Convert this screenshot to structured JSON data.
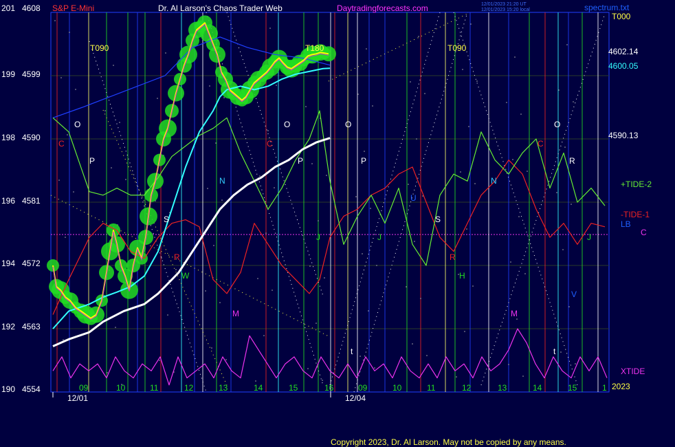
{
  "header": {
    "symbol": "S&P E-Mini",
    "author": "Dr. Al Larson's Chaos Trader Web",
    "site": "Daytradingforecasts.com",
    "stamp_line1": "12/01/2023 21:20 UT",
    "stamp_line2": "12/01/2023 15:20 local",
    "corner": "spectrum.txt"
  },
  "footer": {
    "copyright": "Copyright 2023, Dr. Al Larson. May not be copied by any means."
  },
  "colors": {
    "background": "#00003f",
    "price": "#ffff00",
    "avg_fast": "#33ffff",
    "avg_slow": "#ffffff",
    "tide2": "#66ee33",
    "tide1": "#ee2222",
    "xtide": "#ee33ee",
    "glow": "#22dd22",
    "blue_line": "#1f3fff"
  },
  "chart_data": {
    "type": "line",
    "title": "S&P E-Mini",
    "y_left_labels": [
      "201",
      "199",
      "198",
      "196",
      "194",
      "192",
      "190"
    ],
    "y_price_labels": [
      "4608",
      "4599",
      "4590",
      "4581",
      "4572",
      "4563",
      "4554"
    ],
    "ylim": [
      4554,
      4608
    ],
    "x_hour_labels": [
      "09",
      "10",
      "11",
      "12",
      "13",
      "14",
      "15",
      "16",
      "09",
      "10",
      "11",
      "12",
      "13",
      "14",
      "15",
      "1"
    ],
    "x_date_labels": [
      "12/01",
      "12/04"
    ],
    "year_label": "2023",
    "right_labels": {
      "t000": "T000",
      "price_level_1": "4602.14",
      "price_level_2": "4600.05",
      "price_level_3": "4590.13",
      "tide2": "+TIDE-2",
      "tide1": "-TIDE-1",
      "lb": "LB",
      "c": "C",
      "xtide": "XTIDE"
    },
    "markers": {
      "t090_a": "T090",
      "t180": "T180",
      "t090_b": "T090",
      "o": "O",
      "p": "P",
      "n": "N",
      "c": "C",
      "s": "S",
      "r": "R",
      "h": "H",
      "m": "M",
      "t": "t",
      "u": "U",
      "j": "J",
      "w": "W",
      "v": "V"
    },
    "series": [
      {
        "name": "price",
        "x": [
          77,
          82,
          88,
          95,
          102,
          110,
          118,
          125,
          132,
          140,
          148,
          155,
          160,
          165,
          170,
          176,
          182,
          188,
          194,
          200,
          206,
          212,
          216,
          220,
          226,
          232,
          238,
          244,
          250,
          256,
          262,
          268,
          274,
          280,
          286,
          292,
          298,
          304,
          310,
          316,
          322,
          328,
          334,
          340,
          346,
          352,
          358,
          364,
          370,
          376,
          382,
          388,
          394,
          400,
          406,
          412,
          418,
          424,
          430,
          436,
          442,
          448,
          454,
          460,
          466,
          472,
          478
        ],
        "values": [
          4572,
          4569,
          4568.5,
          4567.5,
          4567,
          4566,
          4565.5,
          4565,
          4564.5,
          4565,
          4567,
          4571,
          4574,
          4577,
          4575,
          4572,
          4570.5,
          4568.5,
          4572,
          4574.5,
          4573,
          4576,
          4579,
          4582,
          4584,
          4587,
          4590,
          4591.5,
          4594,
          4596.5,
          4598.5,
          4600.5,
          4602,
          4604,
          4605.5,
          4606,
          4606.5,
          4605,
          4603.5,
          4602,
          4599.5,
          4598.5,
          4597,
          4596.5,
          4596,
          4595.5,
          4596,
          4597,
          4598,
          4598.5,
          4599,
          4599.5,
          4600.2,
          4601,
          4601.5,
          4600.8,
          4600.2,
          4600,
          4600.4,
          4600.8,
          4601.2,
          4601.8,
          4602,
          4602.1,
          4602.3,
          4602.2,
          4602.1
        ]
      },
      {
        "name": "avg_fast",
        "x": [
          77,
          100,
          130,
          150,
          170,
          190,
          210,
          230,
          250,
          270,
          290,
          310,
          320,
          330,
          350,
          370,
          390,
          410,
          430,
          450,
          470,
          480
        ],
        "values": [
          4563,
          4565.5,
          4566.5,
          4567.5,
          4568.2,
          4569,
          4570.5,
          4574,
          4580,
          4586,
          4591,
          4594,
          4596,
          4597,
          4597.5,
          4597,
          4597.5,
          4598.5,
          4599.2,
          4599.6,
          4600,
          4600.05
        ]
      },
      {
        "name": "avg_slow",
        "x": [
          77,
          100,
          130,
          150,
          180,
          210,
          230,
          260,
          280,
          300,
          320,
          340,
          360,
          380,
          400,
          420,
          440,
          460,
          480
        ],
        "values": [
          4560.5,
          4561.5,
          4562.5,
          4564,
          4565.5,
          4566.5,
          4568,
          4571,
          4574,
          4577,
          4580,
          4582,
          4583.5,
          4584.5,
          4586,
          4587,
          4588.5,
          4589.5,
          4590.13
        ]
      },
      {
        "name": "+TIDE-2",
        "x": [
          77,
          100,
          130,
          150,
          170,
          190,
          210,
          230,
          250,
          270,
          290,
          310,
          330,
          350,
          370,
          390,
          410,
          430,
          450,
          465,
          480,
          500,
          520,
          540,
          560,
          580,
          600,
          620,
          640,
          660,
          680,
          700,
          720,
          740,
          760,
          780,
          800,
          820,
          840,
          860,
          880
        ],
        "values": [
          4593,
          4591,
          4582.5,
          4582,
          4583,
          4582,
          4582,
          4584.5,
          4587.5,
          4589,
          4590.5,
          4591.5,
          4593,
          4588,
          4584,
          4580,
          4583,
          4587,
          4590,
          4594,
          4584,
          4575,
          4579,
          4582,
          4578,
          4583,
          4575,
          4572,
          4582,
          4585,
          4584,
          4591,
          4587,
          4585,
          4588,
          4590,
          4583,
          4588,
          4581,
          4583,
          4580.5
        ]
      },
      {
        "name": "-TIDE-1",
        "x": [
          77,
          100,
          130,
          150,
          170,
          190,
          210,
          230,
          250,
          270,
          290,
          310,
          330,
          350,
          370,
          390,
          410,
          430,
          450,
          465,
          480,
          500,
          520,
          540,
          560,
          580,
          600,
          620,
          640,
          660,
          680,
          700,
          720,
          740,
          760,
          780,
          800,
          820,
          840,
          860,
          880
        ],
        "values": [
          4565,
          4570,
          4576,
          4578,
          4577,
          4574,
          4573,
          4576,
          4578,
          4578.5,
          4577.5,
          4570,
          4568,
          4571,
          4578,
          4575,
          4572,
          4570,
          4568,
          4570,
          4576,
          4579,
          4580,
          4582,
          4583,
          4585,
          4586,
          4581,
          4576,
          4574,
          4578,
          4582,
          4584,
          4587,
          4585,
          4580,
          4576,
          4578,
          4575,
          4578,
          4577.5
        ]
      },
      {
        "name": "XTIDE",
        "x": [
          77,
          90,
          103,
          116,
          129,
          142,
          155,
          168,
          181,
          194,
          207,
          220,
          233,
          246,
          259,
          272,
          285,
          298,
          311,
          324,
          337,
          350,
          363,
          376,
          389,
          402,
          415,
          428,
          441,
          454,
          467,
          480,
          493,
          506,
          519,
          532,
          545,
          558,
          571,
          584,
          597,
          610,
          623,
          636,
          649,
          662,
          675,
          688,
          701,
          714,
          727,
          740,
          753,
          766,
          779,
          792,
          805,
          818,
          831,
          844,
          857,
          870,
          883
        ],
        "values": [
          4557,
          4559,
          4556,
          4558,
          4557,
          4558,
          4556,
          4559,
          4557,
          4556,
          4558,
          4557,
          4559,
          4555,
          4559,
          4556,
          4557,
          4558,
          4556,
          4559,
          4557,
          4556,
          4562,
          4560,
          4558,
          4556,
          4558,
          4559,
          4557,
          4556,
          4559,
          4557,
          4556,
          4558,
          4556,
          4559,
          4557,
          4558,
          4556,
          4559,
          4557,
          4556,
          4558,
          4556,
          4559,
          4557,
          4558,
          4556,
          4559,
          4557,
          4558,
          4560,
          4563,
          4561,
          4558,
          4556,
          4559,
          4557,
          4556,
          4559,
          4557,
          4559,
          4556
        ]
      }
    ]
  }
}
